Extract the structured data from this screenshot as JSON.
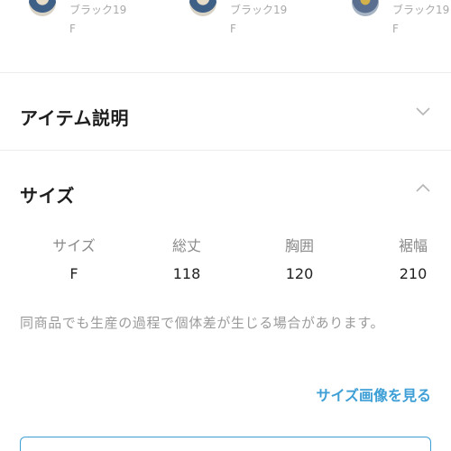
{
  "variants": [
    {
      "name_line1": "ブラック19",
      "name_line2": "F"
    },
    {
      "name_line1": "ブラック19",
      "name_line2": "F"
    },
    {
      "name_line1": "ブラック19",
      "name_line2": "F"
    }
  ],
  "item_description": {
    "title": "アイテム説明",
    "state_icon": "chevron-down-icon"
  },
  "size_section": {
    "title": "サイズ",
    "state_icon": "chevron-up-icon",
    "table": {
      "headers": [
        "サイズ",
        "総丈",
        "胸囲",
        "裾幅"
      ],
      "rows": [
        [
          "F",
          "118",
          "120",
          "210"
        ]
      ]
    },
    "note": "同商品でも生産の過程で個体差が生じる場合があります。",
    "image_link": "サイズ画像を見る"
  },
  "colors": {
    "accent": "#3d9fd6",
    "muted_text": "#9a9a9a"
  }
}
